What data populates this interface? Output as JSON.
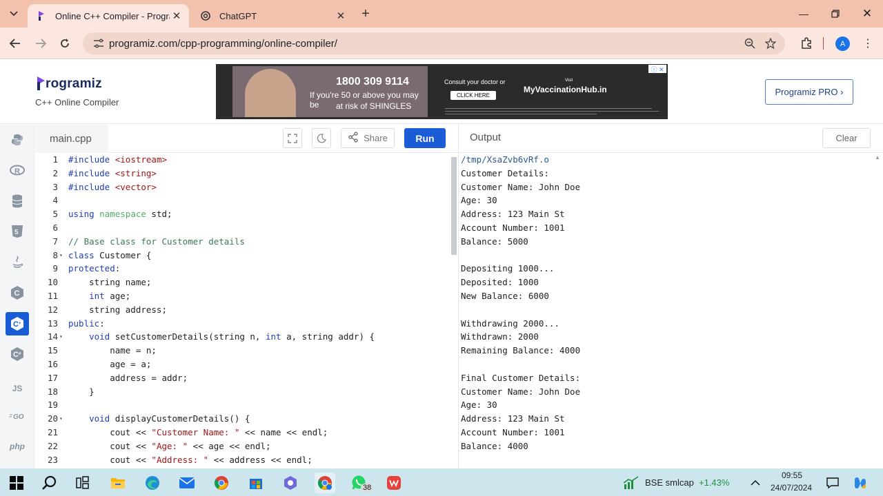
{
  "browser": {
    "tabs": [
      {
        "title": "Online C++ Compiler - Progran",
        "active": true
      },
      {
        "title": "ChatGPT",
        "active": false
      }
    ],
    "url": "programiz.com/cpp-programming/online-compiler/",
    "profile_initial": "A"
  },
  "header": {
    "logo_text": "rogramiz",
    "subtitle": "C++ Online Compiler",
    "pro_button": "Programiz PRO ›"
  },
  "ad": {
    "phone": "1800 309 9114",
    "line1": "If you're 50 or above you may be",
    "line2": "at risk of SHINGLES",
    "consult": "Consult your doctor or",
    "cta": "CLICK HERE",
    "brand": "MyVaccinationHub.in",
    "visit": "Visit"
  },
  "rail": {
    "items": [
      "python",
      "R",
      "sql",
      "html",
      "java",
      "C",
      "C++",
      "C#",
      "JS",
      "GO",
      "php"
    ],
    "active_index": 6
  },
  "editor": {
    "file_name": "main.cpp",
    "share_label": "Share",
    "run_label": "Run",
    "lines": [
      {
        "n": "1",
        "html": "<span class=\"kw\">#include</span> <span class=\"str\">&lt;iostream&gt;</span>"
      },
      {
        "n": "2",
        "html": "<span class=\"kw\">#include</span> <span class=\"str\">&lt;string&gt;</span>"
      },
      {
        "n": "3",
        "html": "<span class=\"kw\">#include</span> <span class=\"str\">&lt;vector&gt;</span>"
      },
      {
        "n": "4",
        "html": ""
      },
      {
        "n": "5",
        "html": "<span class=\"kw\">using</span> <span class=\"ns\">namespace</span> std;"
      },
      {
        "n": "6",
        "html": ""
      },
      {
        "n": "7",
        "html": "<span class=\"cm\">// Base class for Customer details</span>"
      },
      {
        "n": "8",
        "fold": true,
        "html": "<span class=\"kw\">class</span> Customer {"
      },
      {
        "n": "9",
        "html": "<span class=\"kw\">protected</span>:"
      },
      {
        "n": "10",
        "html": "    string name;"
      },
      {
        "n": "11",
        "html": "    <span class=\"ty\">int</span> age;"
      },
      {
        "n": "12",
        "html": "    string address;"
      },
      {
        "n": "13",
        "html": "<span class=\"kw\">public</span>:"
      },
      {
        "n": "14",
        "fold": true,
        "html": "    <span class=\"ty\">void</span> setCustomerDetails(string n, <span class=\"ty\">int</span> a, string addr) {"
      },
      {
        "n": "15",
        "html": "        name = n;"
      },
      {
        "n": "16",
        "html": "        age = a;"
      },
      {
        "n": "17",
        "html": "        address = addr;"
      },
      {
        "n": "18",
        "html": "    }"
      },
      {
        "n": "19",
        "html": ""
      },
      {
        "n": "20",
        "fold": true,
        "html": "    <span class=\"ty\">void</span> displayCustomerDetails() {"
      },
      {
        "n": "21",
        "html": "        cout &lt;&lt; <span class=\"str\">\"Customer Name: \"</span> &lt;&lt; name &lt;&lt; endl;"
      },
      {
        "n": "22",
        "html": "        cout &lt;&lt; <span class=\"str\">\"Age: \"</span> &lt;&lt; age &lt;&lt; endl;"
      },
      {
        "n": "23",
        "html": "        cout &lt;&lt; <span class=\"str\">\"Address: \"</span> &lt;&lt; address &lt;&lt; endl;"
      }
    ]
  },
  "output": {
    "title": "Output",
    "clear_label": "Clear",
    "lines": [
      "/tmp/XsaZvb6vRf.o",
      "Customer Details:",
      "Customer Name: John Doe",
      "Age: 30",
      "Address: 123 Main St",
      "Account Number: 1001",
      "Balance: 5000",
      "",
      "Depositing 1000...",
      "Deposited: 1000",
      "New Balance: 6000",
      "",
      "Withdrawing 2000...",
      "Withdrawn: 2000",
      "Remaining Balance: 4000",
      "",
      "Final Customer Details:",
      "Customer Name: John Doe",
      "Age: 30",
      "Address: 123 Main St",
      "Account Number: 1001",
      "Balance: 4000"
    ]
  },
  "taskbar": {
    "stock_name": "BSE smlcap",
    "stock_change": "+1.43%",
    "time": "09:55",
    "date": "24/07/2024",
    "whatsapp_badge": "38"
  },
  "colors": {
    "accent": "#1a5bd6",
    "tabstrip": "#f2c2ae",
    "stock_up": "#1e8e3e"
  }
}
